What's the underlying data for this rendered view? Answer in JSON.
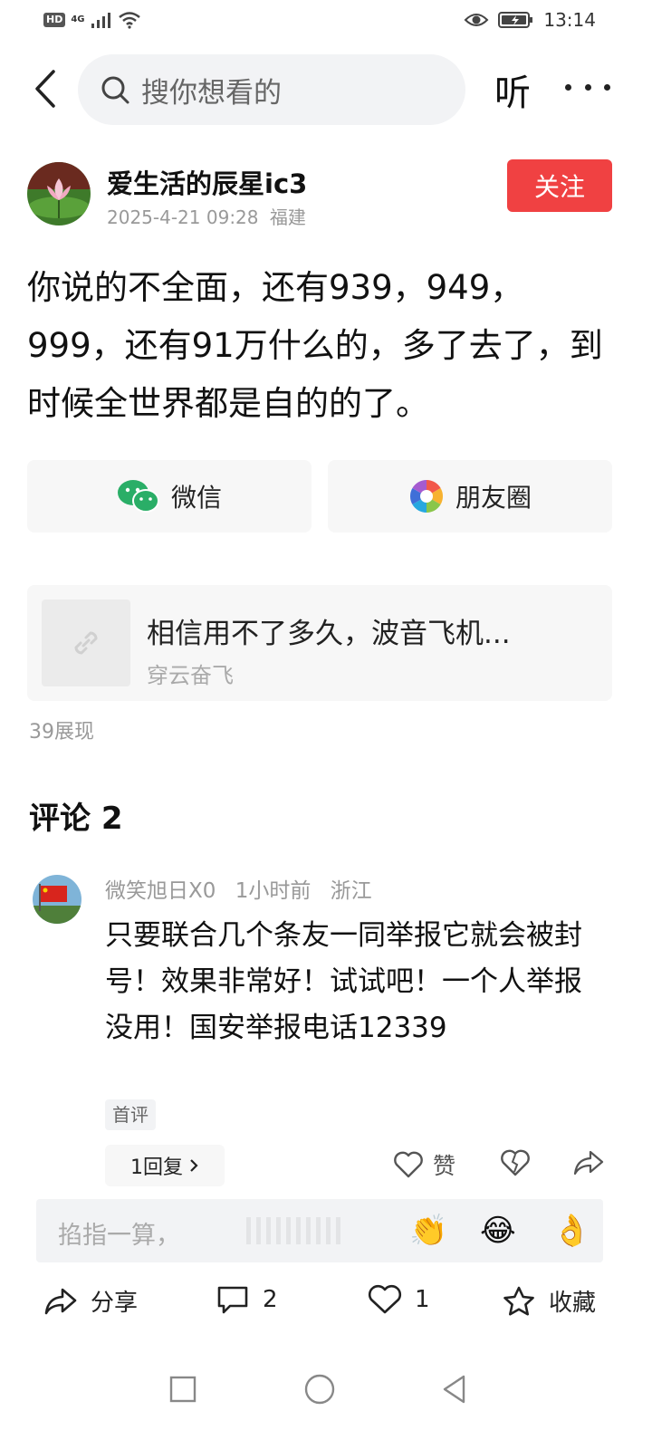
{
  "status_bar": {
    "badge": "HD",
    "network": "4G",
    "time": "13:14"
  },
  "top_bar": {
    "search_placeholder": "搜你想看的",
    "listen_label": "听"
  },
  "author": {
    "name": "爱生活的辰星ic3",
    "date": "2025-4-21 09:28",
    "location": "福建",
    "follow_label": "关注"
  },
  "post": {
    "text": "你说的不全面，还有939，949，999，还有91万什么的，多了去了，到时候全世界都是自的的了。"
  },
  "share": {
    "wechat_label": "微信",
    "moments_label": "朋友圈"
  },
  "link_card": {
    "title": "相信用不了多久，波音飞机...",
    "source": "穿云奋飞"
  },
  "views": "39展现",
  "comments": {
    "title": "评论 2",
    "items": [
      {
        "user": "微笑旭日X0",
        "time": "1小时前",
        "location": "浙江",
        "text": "只要联合几个条友一同举报它就会被封号！效果非常好！试试吧！一个人举报没用！国安举报电话12339",
        "badge": "首评",
        "reply_label": "1回复",
        "like_label": "赞"
      }
    ]
  },
  "comment_input": {
    "placeholder": "掐指一算，",
    "emojis": [
      "👏",
      "😂",
      "👌"
    ]
  },
  "action_bar": {
    "share_label": "分享",
    "comment_count": "2",
    "like_count": "1",
    "favorite_label": "收藏"
  },
  "colors": {
    "accent": "#f04142",
    "wechat": "#2aae67"
  }
}
